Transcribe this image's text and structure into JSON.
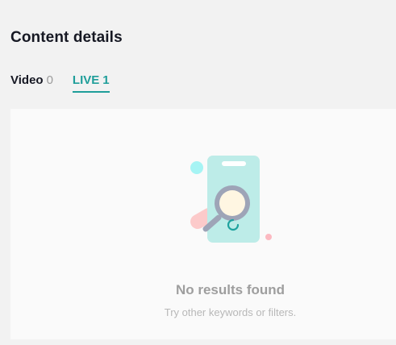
{
  "page": {
    "title": "Content details"
  },
  "tabs": [
    {
      "label": "Video",
      "count": "0"
    },
    {
      "label": "LIVE",
      "count": "1"
    }
  ],
  "empty_state": {
    "icon": "no-results-illustration",
    "title": "No results found",
    "subtitle": "Try other keywords or filters."
  }
}
